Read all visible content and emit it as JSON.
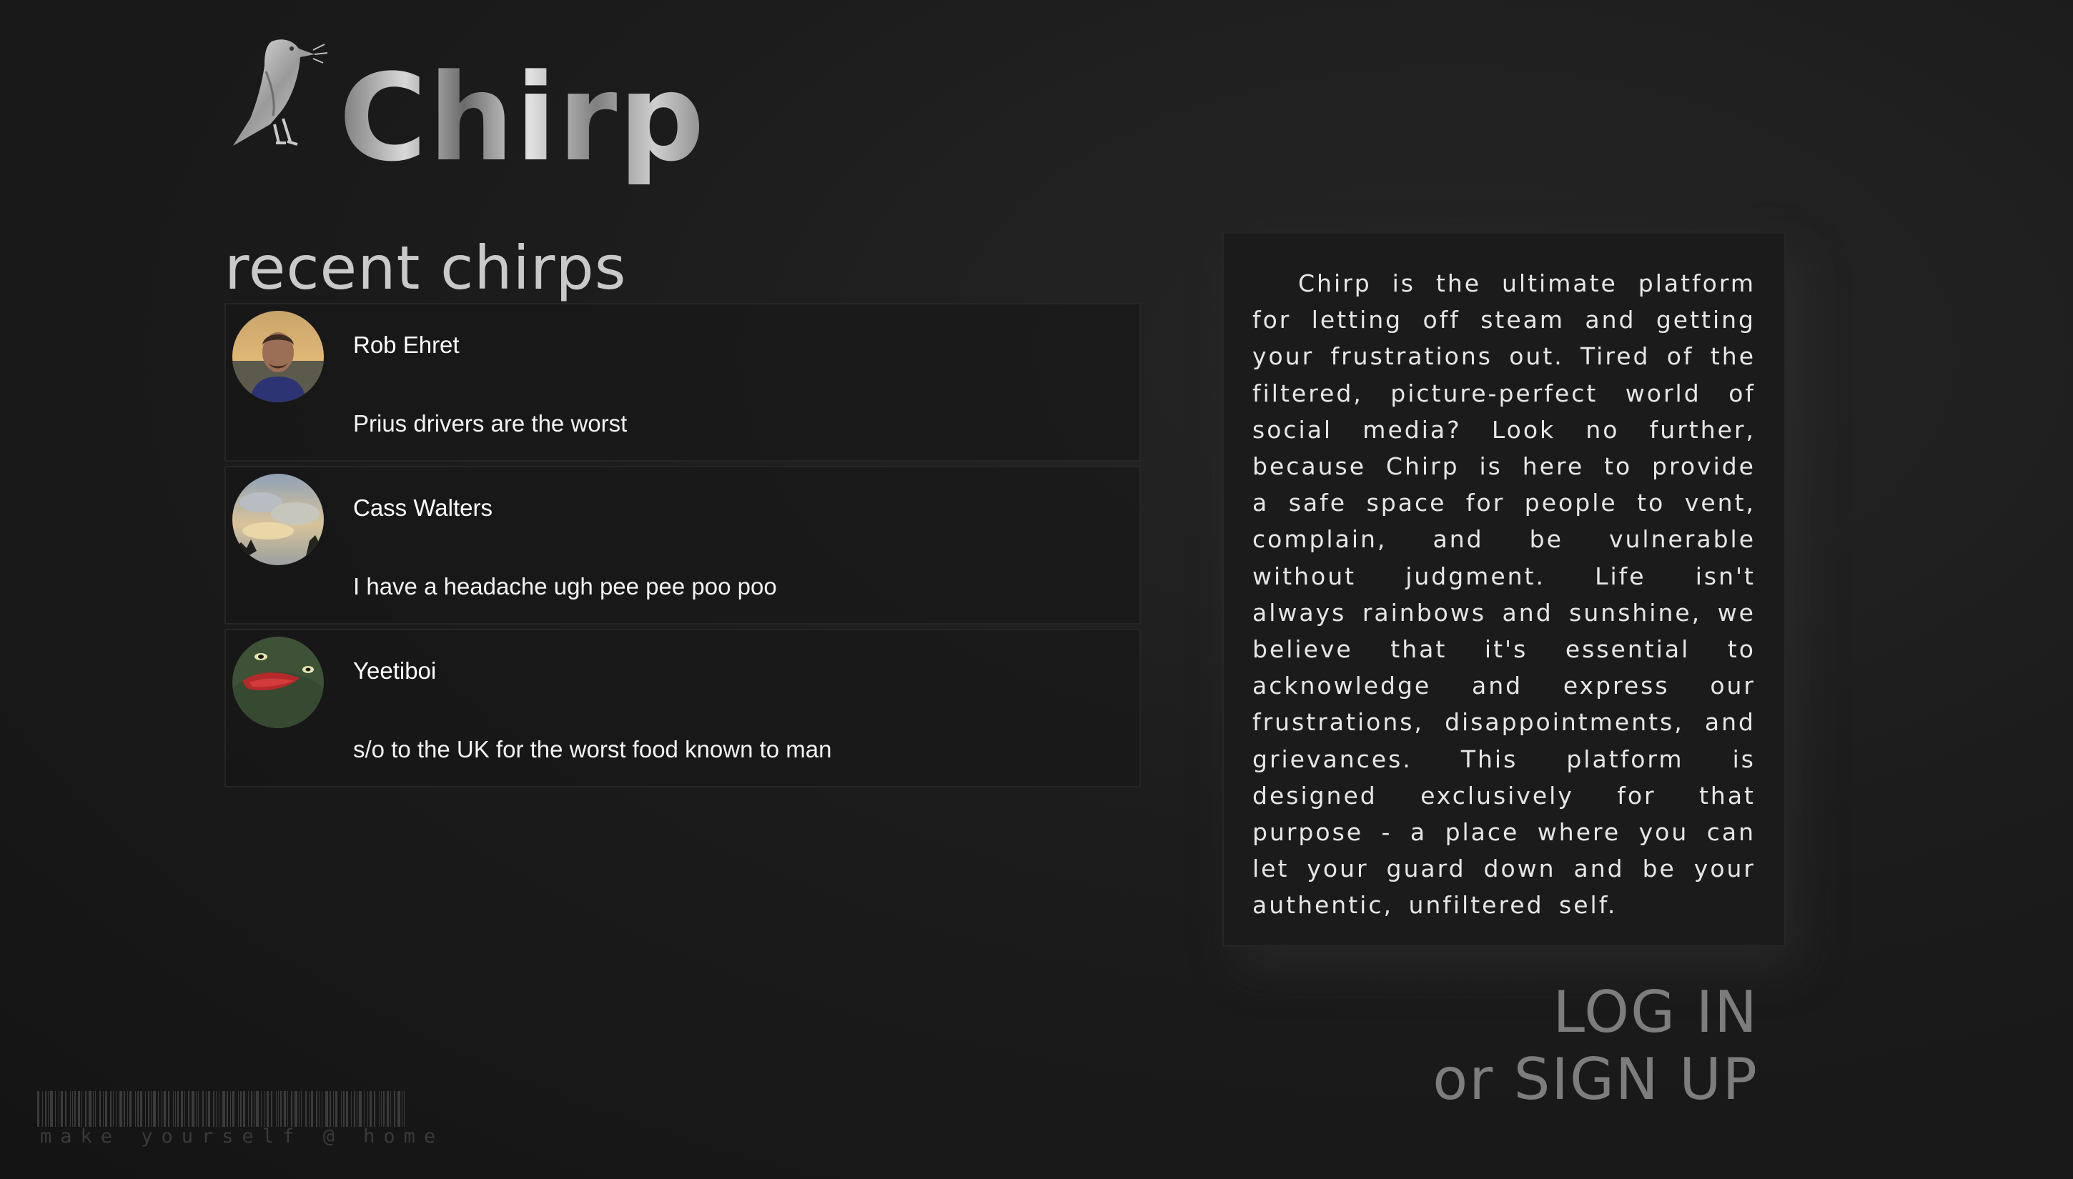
{
  "app": {
    "name": "Chirp"
  },
  "recent": {
    "heading": "recent chirps",
    "chirps": [
      {
        "author": "Rob Ehret",
        "text": "Prius drivers are the worst",
        "avatar": "man-sunset-photo"
      },
      {
        "author": "Cass Walters",
        "text": "I have a headache ugh pee pee poo poo",
        "avatar": "cloudy-sky-photo"
      },
      {
        "author": "Yeetiboi",
        "text": "s/o to the UK for the worst food known to man",
        "avatar": "green-creature-photo"
      }
    ]
  },
  "about": {
    "text": "Chirp is the ultimate platform for letting off steam and getting your frustrations out. Tired of the filtered, picture-perfect world of social media? Look no further, because Chirp is here to provide a safe space for people to vent, complain, and be vulnerable without judgment. Life isn't always rainbows and sunshine, we believe that it's essential to acknowledge and express our frustrations, disappointments, and grievances. This platform is designed exclusively for that purpose - a place where you can let your guard down and be your authentic, unfiltered self."
  },
  "auth": {
    "login_label": "LOG IN",
    "or_label": "or",
    "signup_label": "SIGN UP"
  },
  "footer": {
    "tagline": "make yourself @ home"
  },
  "colors": {
    "background": "#1c1c1c",
    "text": "#e8e8e8",
    "muted": "#7d7d7d",
    "card_border": "#262626"
  }
}
